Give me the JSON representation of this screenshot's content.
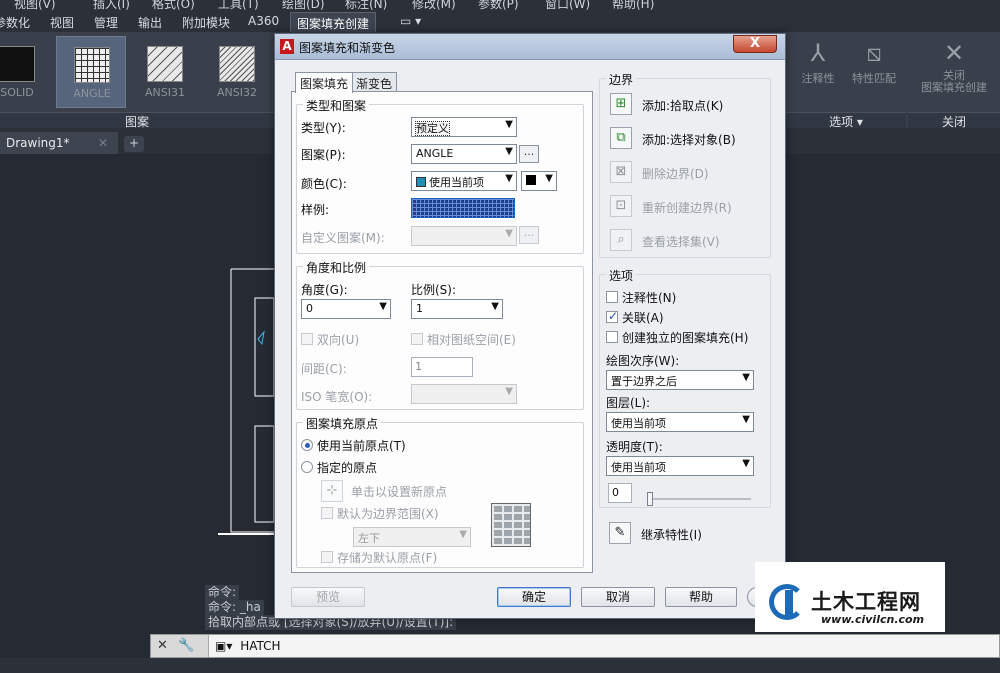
{
  "menubar": {
    "items": [
      "视图(V)",
      "插入(I)",
      "格式(O)",
      "工具(T)",
      "绘图(D)",
      "标注(N)",
      "修改(M)",
      "参数(P)",
      "窗口(W)",
      "帮助(H)"
    ]
  },
  "ribbon_tabs": {
    "items": [
      "参数化",
      "视图",
      "管理",
      "输出",
      "附加模块",
      "A360"
    ],
    "active": "图案填充创建"
  },
  "ribbon": {
    "patterns": [
      "SOLID",
      "ANGLE",
      "ANSI31",
      "ANSI32"
    ],
    "selected_pattern": "ANGLE",
    "panel_pattern": "图案",
    "annotative": "注释性",
    "match_props": "特性匹配",
    "options_panel": "选项 ▾",
    "close_label": "关闭\n图案填充创建",
    "close_panel": "关闭"
  },
  "doc": {
    "tab": "Drawing1*",
    "add": "+"
  },
  "cmd": {
    "line1": "命令:",
    "line2": "命令: _ha",
    "line3": "拾取内部点或 [选择对象(S)/放弃(U)/设置(T)]:",
    "current": "HATCH"
  },
  "dialog": {
    "title": "图案填充和渐变色",
    "close": "X",
    "tabs": [
      "图案填充",
      "渐变色"
    ],
    "type_group": "类型和图案",
    "type_label": "类型(Y):",
    "type_value": "预定义",
    "pattern_label": "图案(P):",
    "pattern_value": "ANGLE",
    "color_label": "颜色(C):",
    "color_value": "使用当前项",
    "sample_label": "样例:",
    "custom_label": "自定义图案(M):",
    "angle_group": "角度和比例",
    "angle_label": "角度(G):",
    "angle_value": "0",
    "scale_label": "比例(S):",
    "scale_value": "1",
    "double_label": "双向(U)",
    "relative_label": "相对图纸空间(E)",
    "spacing_label": "间距(C):",
    "spacing_value": "1",
    "iso_label": "ISO 笔宽(O):",
    "origin_group": "图案填充原点",
    "use_current_origin": "使用当前原点(T)",
    "specified_origin": "指定的原点",
    "click_set_origin": "单击以设置新原点",
    "default_extent": "默认为边界范围(X)",
    "extent_value": "左下",
    "store_default": "存储为默认原点(F)",
    "boundary_group": "边界",
    "add_pick": "添加:拾取点(K)",
    "add_select": "添加:选择对象(B)",
    "remove_boundary": "删除边界(D)",
    "recreate_boundary": "重新创建边界(R)",
    "view_selection": "查看选择集(V)",
    "options_group": "选项",
    "annotative": "注释性(N)",
    "associative": "关联(A)",
    "separate": "创建独立的图案填充(H)",
    "draw_order_label": "绘图次序(W):",
    "draw_order_value": "置于边界之后",
    "layer_label": "图层(L):",
    "layer_value": "使用当前项",
    "transparency_label": "透明度(T):",
    "transparency_value": "使用当前项",
    "transparency_num": "0",
    "inherit": "继承特性(I)",
    "preview": "预览",
    "ok": "确定",
    "cancel": "取消",
    "help": "帮助"
  },
  "watermark": {
    "title": "土木工程网",
    "url": "www.civilcn.com"
  }
}
